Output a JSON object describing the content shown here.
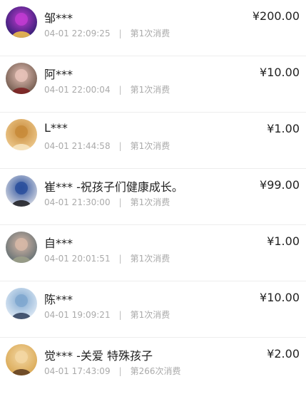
{
  "donations": [
    {
      "name": "邹***",
      "time": "04-01 22:09:25",
      "count": "第1次消费",
      "amount": "¥200.00",
      "avatar": "user-avatar-icon",
      "colors": [
        "#1d1a66",
        "#c13bd1",
        "#f6c54a"
      ]
    },
    {
      "name": "阿***",
      "time": "04-01 22:00:04",
      "count": "第1次消费",
      "amount": "¥10.00",
      "avatar": "user-avatar-icon",
      "colors": [
        "#5f4a3d",
        "#e7c2b8",
        "#7b1f20"
      ]
    },
    {
      "name": "L***",
      "time": "04-01 21:44:58",
      "count": "第1次消费",
      "amount": "¥1.00",
      "avatar": "user-avatar-icon",
      "colors": [
        "#f2d198",
        "#c88b3a",
        "#f8e8c4"
      ]
    },
    {
      "name": "崔*** -祝孩子们健康成长。",
      "time": "04-01 21:30:00",
      "count": "第1次消费",
      "amount": "¥99.00",
      "avatar": "user-avatar-icon",
      "colors": [
        "#e7e7e9",
        "#2a4f9c",
        "#1b1b1f"
      ]
    },
    {
      "name": "自***",
      "time": "04-01 20:01:51",
      "count": "第1次消费",
      "amount": "¥1.00",
      "avatar": "user-avatar-icon",
      "colors": [
        "#54666c",
        "#d7b8a7",
        "#9ea18a"
      ]
    },
    {
      "name": "陈***",
      "time": "04-01 19:09:21",
      "count": "第1次消费",
      "amount": "¥10.00",
      "avatar": "user-avatar-icon",
      "colors": [
        "#eaf2fa",
        "#7fa7cf",
        "#2d3d5a"
      ]
    },
    {
      "name": "觉*** -关爱 特殊孩子",
      "time": "04-01 17:43:09",
      "count": "第266次消费",
      "amount": "¥2.00",
      "avatar": "user-avatar-icon",
      "colors": [
        "#d6a24a",
        "#f3d7a3",
        "#5d3b1f"
      ]
    }
  ]
}
